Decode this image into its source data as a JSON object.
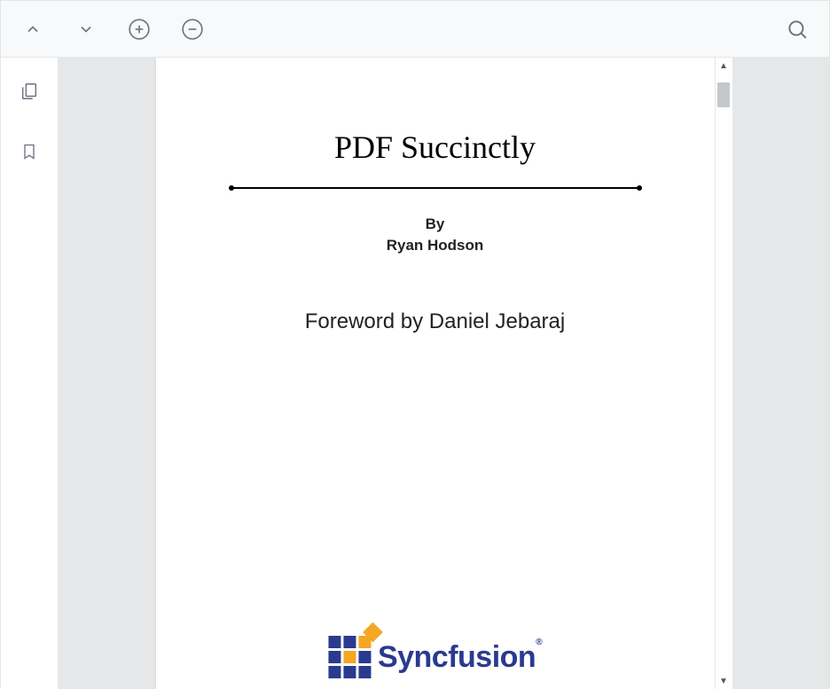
{
  "toolbar": {
    "prev_page_label": "Previous Page",
    "next_page_label": "Next Page",
    "zoom_in_label": "Zoom In",
    "zoom_out_label": "Zoom Out",
    "search_label": "Search"
  },
  "sidebar": {
    "thumbnails_label": "Page Thumbnails",
    "bookmarks_label": "Bookmarks"
  },
  "document": {
    "title": "PDF Succinctly",
    "by_label": "By",
    "author": "Ryan Hodson",
    "foreword": "Foreword by Daniel Jebaraj",
    "publisher": "Syncfusion"
  }
}
